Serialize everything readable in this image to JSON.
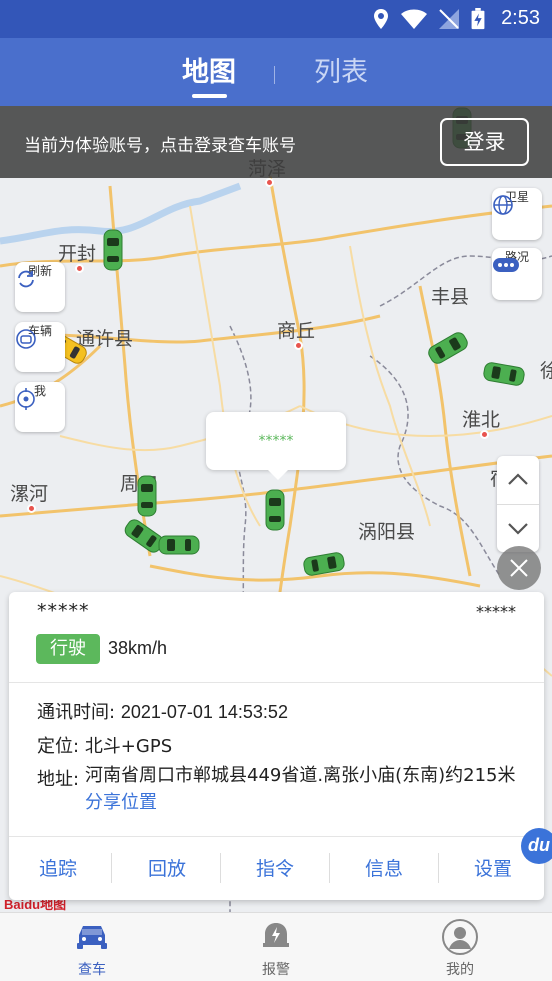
{
  "status_bar": {
    "time": "2:53"
  },
  "header": {
    "tabs": [
      {
        "label": "地图",
        "active": true
      },
      {
        "label": "列表",
        "active": false
      }
    ]
  },
  "banner": {
    "text": "当前为体验账号，点击登录查车账号",
    "login_label": "登录"
  },
  "map_controls": {
    "satellite_label": "卫星",
    "traffic_label": "路况",
    "refresh_label": "刷新",
    "vehicle_label": "车辆",
    "me_label": "我"
  },
  "map": {
    "cities": [
      "开封",
      "通许县",
      "商丘",
      "丰县",
      "淮北",
      "漯河",
      "周口",
      "涡阳县",
      "菏泽",
      "徐",
      "宿"
    ],
    "bubble_text": "*****",
    "logo": "Baidu地图"
  },
  "vehicle_card": {
    "name": "*****",
    "id": "*****",
    "status": "行驶",
    "speed": "38km/h",
    "comm_time_label": "通讯时间:",
    "comm_time": "2021-07-01 14:53:52",
    "positioning_label": "定位:",
    "positioning": "北斗+GPS",
    "address_label": "地址:",
    "address": "河南省周口市郸城县449省道.离张小庙(东南)约215米",
    "share_label": "分享位置",
    "actions": [
      "追踪",
      "回放",
      "指令",
      "信息",
      "设置"
    ]
  },
  "bottom_nav": {
    "items": [
      {
        "label": "查车",
        "icon": "car-icon",
        "active": true
      },
      {
        "label": "报警",
        "icon": "alarm-icon",
        "active": false
      },
      {
        "label": "我的",
        "icon": "profile-icon",
        "active": false
      }
    ]
  },
  "colors": {
    "primary": "#4a6fcc",
    "status_bar": "#3356b8",
    "moving_green": "#5cb85c",
    "link_blue": "#3b73d9"
  }
}
